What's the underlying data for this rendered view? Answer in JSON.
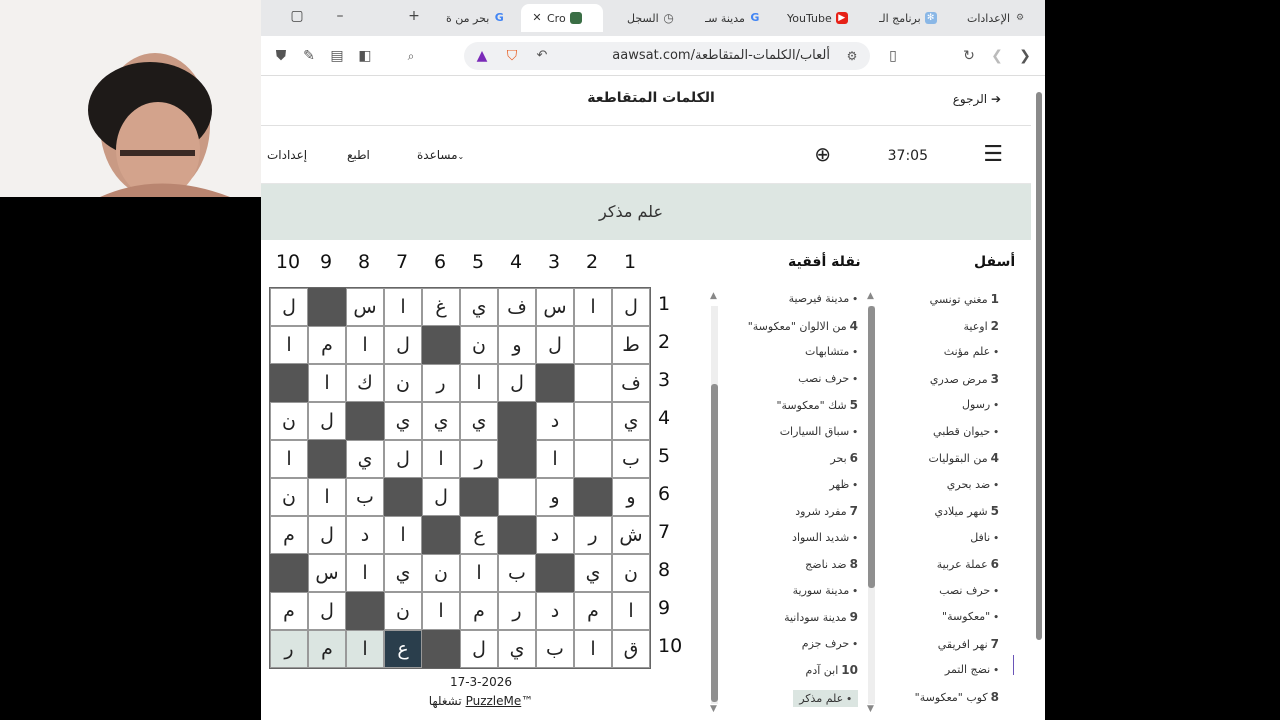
{
  "tabs": [
    {
      "label": "الإعدادات",
      "icon": "gear-icon"
    },
    {
      "label": "برنامج الـ",
      "icon": "app-icon"
    },
    {
      "label": "YouTube",
      "icon": "youtube-icon"
    },
    {
      "label": "مدينة سـ",
      "icon": "google-icon"
    },
    {
      "label": "السجل",
      "icon": "history-icon"
    },
    {
      "label": "Cro",
      "icon": "flag-icon"
    },
    {
      "label": "بحر من ة",
      "icon": "google-icon"
    }
  ],
  "url": "aawsat.com/ألعاب/الكلمات-المتقاطعة",
  "site": {
    "title": "الكلمات المتقاطعة",
    "back": "الرجوع"
  },
  "menu": {
    "timer": "37:05",
    "help": "مساعدة",
    "print": "اطبع",
    "settings": "إعدادات"
  },
  "current_clue": "علم مذكر",
  "column_numbers": [
    "10",
    "9",
    "8",
    "7",
    "6",
    "5",
    "4",
    "3",
    "2",
    "1"
  ],
  "row_numbers": [
    "1",
    "2",
    "3",
    "4",
    "5",
    "6",
    "7",
    "8",
    "9",
    "10"
  ],
  "grid": [
    [
      "ل",
      "#",
      "س",
      "ا",
      "غ",
      "ي",
      "ف",
      "س",
      "ا",
      "ل"
    ],
    [
      "ا",
      "م",
      "ا",
      "ل",
      "#",
      "ن",
      "و",
      "ل",
      "",
      "ط"
    ],
    [
      "#",
      "ا",
      "ك",
      "ن",
      "ر",
      "ا",
      "ل",
      "#",
      "",
      "ف"
    ],
    [
      "ن",
      "ل",
      "#",
      "ي",
      "ي",
      "ي",
      "#",
      "د",
      "",
      "ي"
    ],
    [
      "ا",
      "#",
      "ي",
      "ل",
      "ا",
      "ر",
      "#",
      "ا",
      "",
      "ب"
    ],
    [
      "ن",
      "ا",
      "ب",
      "#",
      "ل",
      "#",
      "",
      "و",
      "#",
      "و"
    ],
    [
      "م",
      "ل",
      "د",
      "ا",
      "#",
      "ع",
      "#",
      "د",
      "ر",
      "ش"
    ],
    [
      "#",
      "س",
      "ا",
      "ي",
      "ن",
      "ا",
      "ب",
      "#",
      "ي",
      "ن"
    ],
    [
      "م",
      "ل",
      "#",
      "ن",
      "ا",
      "م",
      "ر",
      "د",
      "م",
      "ا"
    ],
    [
      "ر",
      "م",
      "ا",
      "ع",
      "#",
      "ل",
      "ي",
      "ب",
      "ا",
      "ق"
    ]
  ],
  "date": "17-3-2026",
  "credit_brand": "PuzzleMe",
  "credit_tm": "™",
  "credit_text": "تشغلها",
  "across_header": "نقلة أفقية",
  "down_header": "أسفل",
  "across_clues": [
    {
      "num": "",
      "text": "مدينة فيرصية"
    },
    {
      "num": "4",
      "text": "من الالوان \"معكوسة\""
    },
    {
      "num": "",
      "text": "متشابهات"
    },
    {
      "num": "",
      "text": "حرف نصب"
    },
    {
      "num": "5",
      "text": "شك \"معكوسة\""
    },
    {
      "num": "",
      "text": "سباق السيارات"
    },
    {
      "num": "6",
      "text": "بحر"
    },
    {
      "num": "",
      "text": "ظهر"
    },
    {
      "num": "7",
      "text": "مفرد شرود"
    },
    {
      "num": "",
      "text": "شديد السواد"
    },
    {
      "num": "8",
      "text": "ضد ناضج"
    },
    {
      "num": "",
      "text": "مدينة سورية"
    },
    {
      "num": "9",
      "text": "مدينة سودانية"
    },
    {
      "num": "",
      "text": "حرف جزم"
    },
    {
      "num": "10",
      "text": "ابن آدم"
    },
    {
      "num": "",
      "text": "علم مذكر"
    }
  ],
  "down_clues": [
    {
      "num": "1",
      "text": "مغني تونسي"
    },
    {
      "num": "2",
      "text": "اوعية"
    },
    {
      "num": "",
      "text": "علم مؤنث"
    },
    {
      "num": "3",
      "text": "مرض صدري"
    },
    {
      "num": "",
      "text": "رسول"
    },
    {
      "num": "",
      "text": "حيوان قطبي"
    },
    {
      "num": "4",
      "text": "من البقوليات"
    },
    {
      "num": "",
      "text": "ضد بحري"
    },
    {
      "num": "5",
      "text": "شهر ميلادي"
    },
    {
      "num": "",
      "text": "نافل"
    },
    {
      "num": "6",
      "text": "عملة عربية"
    },
    {
      "num": "",
      "text": "حرف نصب"
    },
    {
      "num": "",
      "text": "\"معكوسة\""
    },
    {
      "num": "7",
      "text": "نهر افريقي"
    },
    {
      "num": "",
      "text": "نضج التمر"
    },
    {
      "num": "8",
      "text": "كوب \"معكوسة\""
    }
  ],
  "colors": {
    "highlight": "#dbe5e1",
    "selected": "#2a3e4c",
    "block": "#555555"
  }
}
